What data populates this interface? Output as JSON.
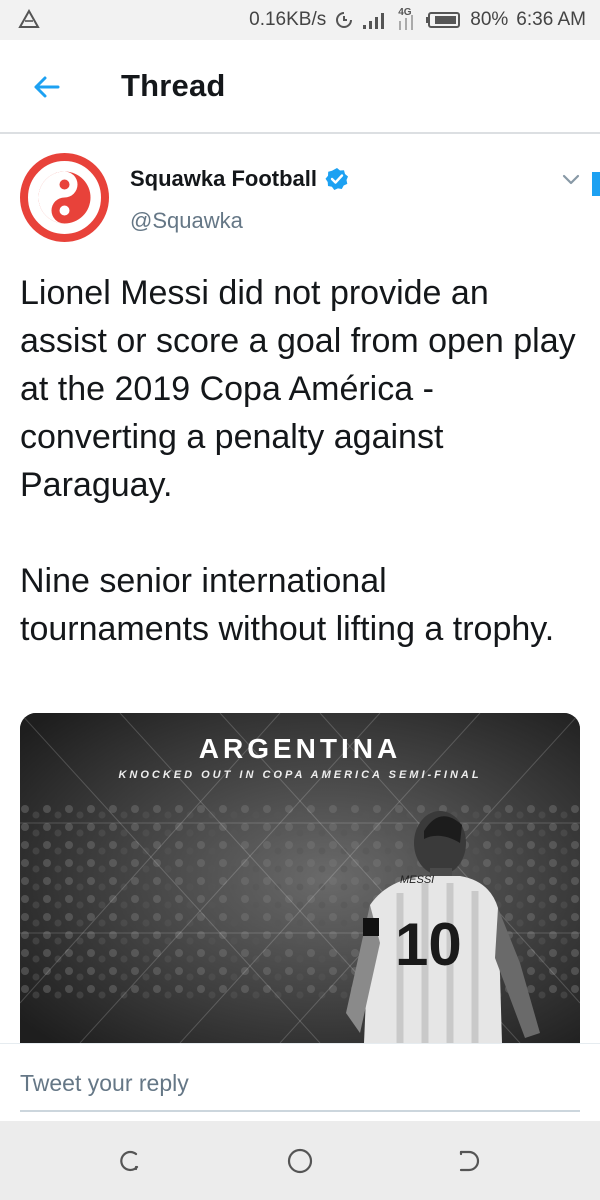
{
  "status_bar": {
    "net_speed": "0.16KB/s",
    "network_type": "4G",
    "battery": "80%",
    "time": "6:36 AM",
    "icons": [
      "warning-triangle-icon",
      "data-saver-icon",
      "signal-icon",
      "network-4g-icon",
      "battery-icon"
    ]
  },
  "header": {
    "back_icon": "back-arrow-icon",
    "title": "Thread"
  },
  "tweet": {
    "author_name": "Squawka Football",
    "author_handle": "@Squawka",
    "verified": true,
    "paragraphs": [
      "Lionel Messi did not provide an assist or score a goal from open play at the 2019 Copa América - converting a penalty against Paraguay.",
      "Nine senior international tournaments without lifting a trophy."
    ],
    "media": {
      "title": "ARGENTINA",
      "subtitle": "KNOCKED OUT IN COPA AMERICA SEMI-FINAL",
      "jersey_name": "MESSI",
      "jersey_number": "10"
    }
  },
  "reply": {
    "placeholder": "Tweet your reply"
  },
  "colors": {
    "accent": "#1da1f2",
    "brand_red": "#e8423a",
    "text_primary": "#14171a",
    "text_secondary": "#657786"
  },
  "nav_bar": {
    "icons": [
      "recent-apps-icon",
      "home-icon",
      "back-icon"
    ]
  }
}
